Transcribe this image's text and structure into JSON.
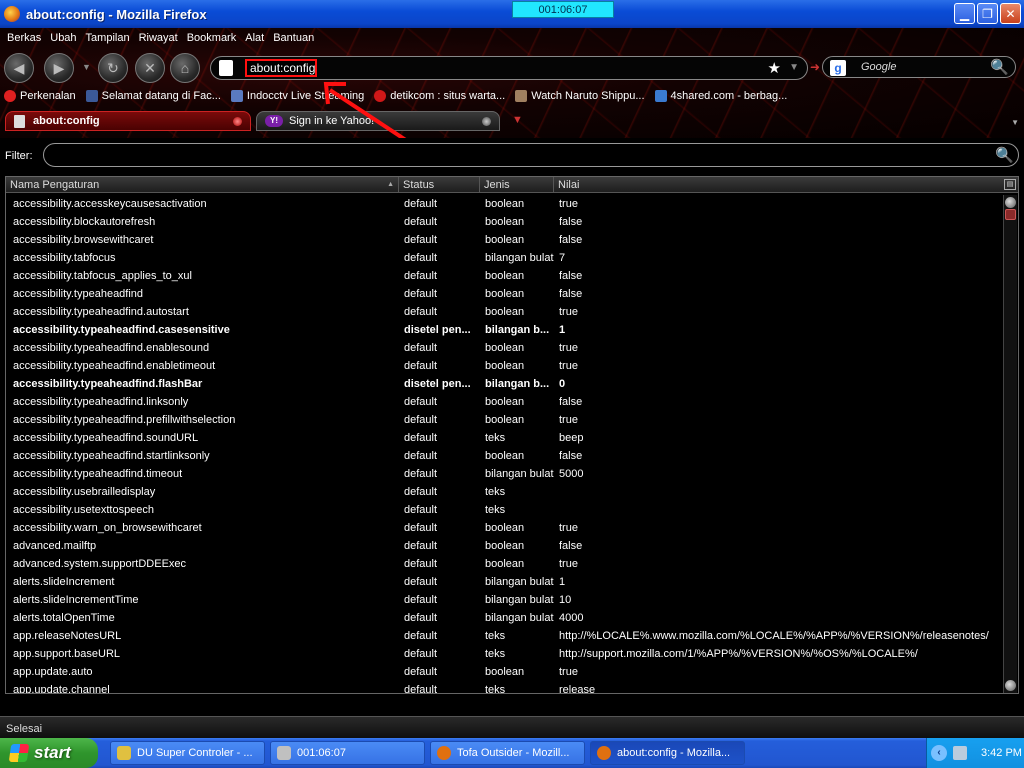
{
  "window": {
    "title": "about:config - Mozilla Firefox",
    "timer": "001:06:07"
  },
  "menu": [
    "Berkas",
    "Ubah",
    "Tampilan",
    "Riwayat",
    "Bookmark",
    "Alat",
    "Bantuan"
  ],
  "nav": {
    "url": "about:config",
    "search_placeholder": "Google"
  },
  "bookmarks": [
    {
      "label": "Perkenalan",
      "color": "#e02020"
    },
    {
      "label": "Selamat datang di Fac...",
      "color": "#3b5998"
    },
    {
      "label": "Indocctv Live Streaming",
      "color": "#5a7ac0"
    },
    {
      "label": "detikcom : situs warta...",
      "color": "#d01818"
    },
    {
      "label": "Watch Naruto Shippu...",
      "color": "#a08060"
    },
    {
      "label": "4shared.com - berbag...",
      "color": "#3a7ad0"
    }
  ],
  "tabs": [
    {
      "label": "about:config",
      "active": true
    },
    {
      "label": "Sign in ke Yahoo!",
      "active": false
    }
  ],
  "filter": {
    "label": "Filter:",
    "value": ""
  },
  "columns": [
    "Nama Pengaturan",
    "Status",
    "Jenis",
    "Nilai"
  ],
  "prefs": [
    {
      "name": "accessibility.accesskeycausesactivation",
      "status": "default",
      "type": "boolean",
      "value": "true",
      "modified": false
    },
    {
      "name": "accessibility.blockautorefresh",
      "status": "default",
      "type": "boolean",
      "value": "false",
      "modified": false
    },
    {
      "name": "accessibility.browsewithcaret",
      "status": "default",
      "type": "boolean",
      "value": "false",
      "modified": false
    },
    {
      "name": "accessibility.tabfocus",
      "status": "default",
      "type": "bilangan bulat",
      "value": "7",
      "modified": false
    },
    {
      "name": "accessibility.tabfocus_applies_to_xul",
      "status": "default",
      "type": "boolean",
      "value": "false",
      "modified": false
    },
    {
      "name": "accessibility.typeaheadfind",
      "status": "default",
      "type": "boolean",
      "value": "false",
      "modified": false
    },
    {
      "name": "accessibility.typeaheadfind.autostart",
      "status": "default",
      "type": "boolean",
      "value": "true",
      "modified": false
    },
    {
      "name": "accessibility.typeaheadfind.casesensitive",
      "status": "disetel pen...",
      "type": "bilangan b...",
      "value": "1",
      "modified": true
    },
    {
      "name": "accessibility.typeaheadfind.enablesound",
      "status": "default",
      "type": "boolean",
      "value": "true",
      "modified": false
    },
    {
      "name": "accessibility.typeaheadfind.enabletimeout",
      "status": "default",
      "type": "boolean",
      "value": "true",
      "modified": false
    },
    {
      "name": "accessibility.typeaheadfind.flashBar",
      "status": "disetel pen...",
      "type": "bilangan b...",
      "value": "0",
      "modified": true
    },
    {
      "name": "accessibility.typeaheadfind.linksonly",
      "status": "default",
      "type": "boolean",
      "value": "false",
      "modified": false
    },
    {
      "name": "accessibility.typeaheadfind.prefillwithselection",
      "status": "default",
      "type": "boolean",
      "value": "true",
      "modified": false
    },
    {
      "name": "accessibility.typeaheadfind.soundURL",
      "status": "default",
      "type": "teks",
      "value": "beep",
      "modified": false
    },
    {
      "name": "accessibility.typeaheadfind.startlinksonly",
      "status": "default",
      "type": "boolean",
      "value": "false",
      "modified": false
    },
    {
      "name": "accessibility.typeaheadfind.timeout",
      "status": "default",
      "type": "bilangan bulat",
      "value": "5000",
      "modified": false
    },
    {
      "name": "accessibility.usebrailledisplay",
      "status": "default",
      "type": "teks",
      "value": "",
      "modified": false
    },
    {
      "name": "accessibility.usetexttospeech",
      "status": "default",
      "type": "teks",
      "value": "",
      "modified": false
    },
    {
      "name": "accessibility.warn_on_browsewithcaret",
      "status": "default",
      "type": "boolean",
      "value": "true",
      "modified": false
    },
    {
      "name": "advanced.mailftp",
      "status": "default",
      "type": "boolean",
      "value": "false",
      "modified": false
    },
    {
      "name": "advanced.system.supportDDEExec",
      "status": "default",
      "type": "boolean",
      "value": "true",
      "modified": false
    },
    {
      "name": "alerts.slideIncrement",
      "status": "default",
      "type": "bilangan bulat",
      "value": "1",
      "modified": false
    },
    {
      "name": "alerts.slideIncrementTime",
      "status": "default",
      "type": "bilangan bulat",
      "value": "10",
      "modified": false
    },
    {
      "name": "alerts.totalOpenTime",
      "status": "default",
      "type": "bilangan bulat",
      "value": "4000",
      "modified": false
    },
    {
      "name": "app.releaseNotesURL",
      "status": "default",
      "type": "teks",
      "value": "http://%LOCALE%.www.mozilla.com/%LOCALE%/%APP%/%VERSION%/releasenotes/",
      "modified": false
    },
    {
      "name": "app.support.baseURL",
      "status": "default",
      "type": "teks",
      "value": "http://support.mozilla.com/1/%APP%/%VERSION%/%OS%/%LOCALE%/",
      "modified": false
    },
    {
      "name": "app.update.auto",
      "status": "default",
      "type": "boolean",
      "value": "true",
      "modified": false
    },
    {
      "name": "app.update.channel",
      "status": "default",
      "type": "teks",
      "value": "release",
      "modified": false
    }
  ],
  "status": {
    "text": "Selesai"
  },
  "taskbar": {
    "start": "start",
    "tasks": [
      {
        "label": "DU Super Controler - ...",
        "color": "#e0c040",
        "active": false
      },
      {
        "label": "001:06:07",
        "color": "#c0c0c0",
        "active": false
      },
      {
        "label": "Tofa Outsider - Mozill...",
        "color": "#e07010",
        "active": false
      },
      {
        "label": "about:config - Mozilla...",
        "color": "#e07010",
        "active": true
      }
    ],
    "clock": "3:42 PM"
  }
}
